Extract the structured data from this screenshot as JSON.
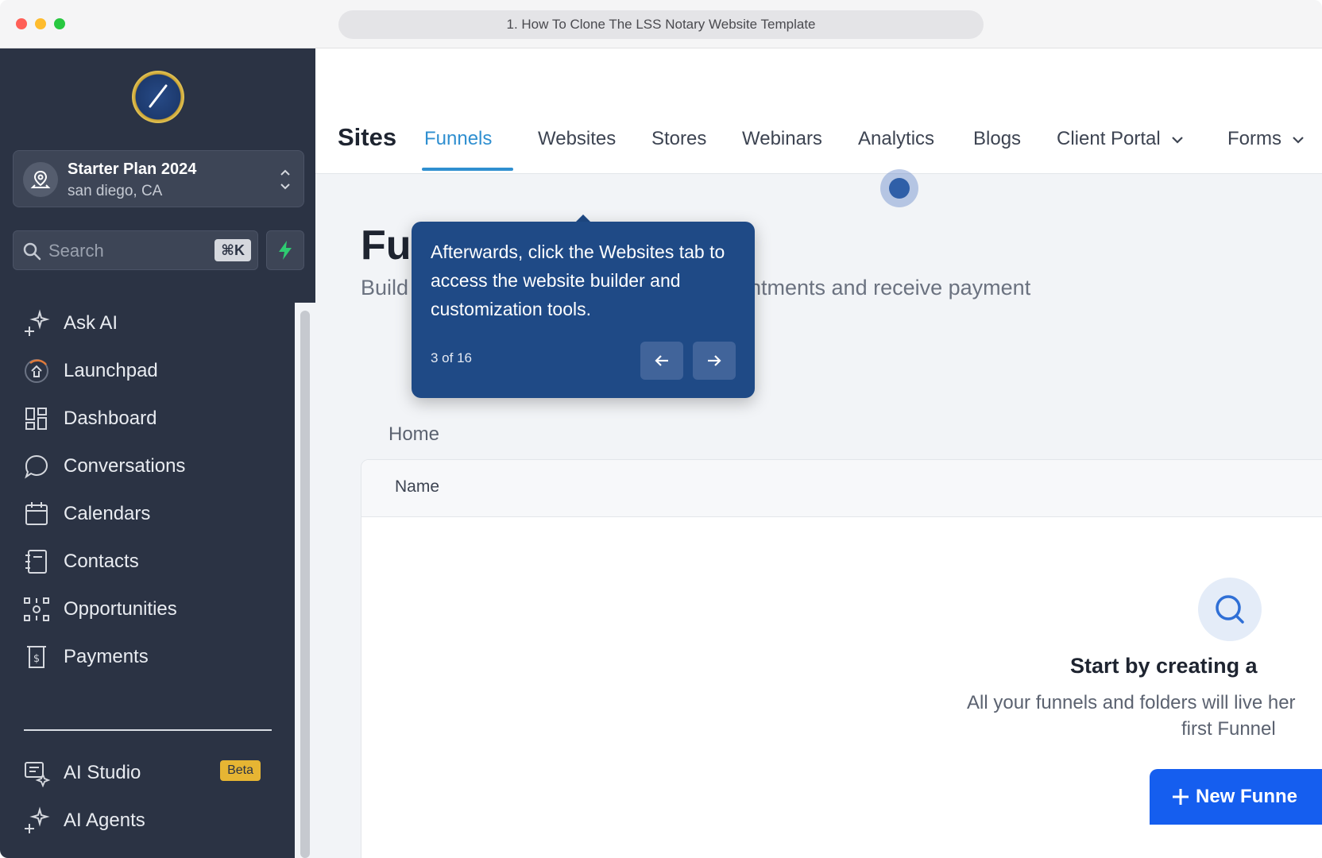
{
  "window": {
    "url_title": "1. How To Clone The LSS Notary Website Template"
  },
  "sidebar": {
    "plan": {
      "title": "Starter Plan 2024",
      "location": "san diego, CA"
    },
    "search": {
      "placeholder": "Search",
      "shortcut": "⌘K"
    },
    "items": [
      {
        "label": "Ask AI",
        "icon": "sparkle-icon"
      },
      {
        "label": "Launchpad",
        "icon": "launchpad-icon"
      },
      {
        "label": "Dashboard",
        "icon": "dashboard-icon"
      },
      {
        "label": "Conversations",
        "icon": "chat-bubble-icon"
      },
      {
        "label": "Calendars",
        "icon": "calendar-icon"
      },
      {
        "label": "Contacts",
        "icon": "contacts-icon"
      },
      {
        "label": "Opportunities",
        "icon": "opportunities-icon"
      },
      {
        "label": "Payments",
        "icon": "payments-icon"
      }
    ],
    "lower_items": [
      {
        "label": "AI Studio",
        "icon": "ai-studio-icon",
        "badge": "Beta"
      },
      {
        "label": "AI Agents",
        "icon": "sparkle-icon"
      }
    ]
  },
  "topnav": {
    "title": "Sites",
    "tabs": [
      {
        "label": "Funnels",
        "active": true
      },
      {
        "label": "Websites"
      },
      {
        "label": "Stores"
      },
      {
        "label": "Webinars"
      },
      {
        "label": "Analytics"
      },
      {
        "label": "Blogs"
      },
      {
        "label": "Client Portal"
      },
      {
        "label": "Forms"
      }
    ]
  },
  "main": {
    "heading": "Fu",
    "subtitle_left": "Build",
    "subtitle_right": "intments and receive payment",
    "breadcrumb": "Home",
    "table": {
      "columns": [
        "Name"
      ]
    },
    "empty_state": {
      "title": "Start by creating a",
      "desc_line1": "All your funnels and folders will live her",
      "desc_line2": "first Funnel",
      "button": "New Funne"
    }
  },
  "tooltip": {
    "text": "Afterwards, click the Websites tab to access the website builder and customization tools.",
    "step": "3 of 16"
  },
  "colors": {
    "sidebar_bg": "#2b3344",
    "accent_tab": "#2f8fd0",
    "tooltip_bg": "#1f4a86",
    "primary_button": "#155eef",
    "beta_badge": "#e6b533"
  }
}
